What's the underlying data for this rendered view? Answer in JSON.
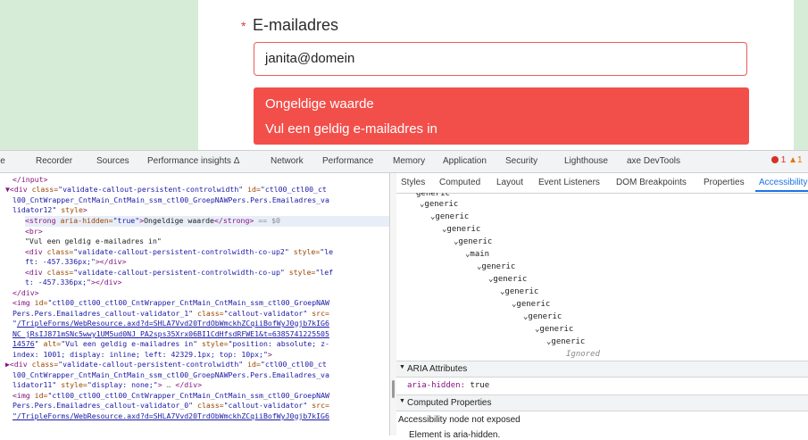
{
  "page": {
    "required_marker": "*",
    "email_label": "E-mailadres",
    "email_value": "janita@domein",
    "error_title": "Ongeldige waarde",
    "error_message": "Vul een geldig e-mailadres in"
  },
  "devtools": {
    "tabs": [
      "le",
      "Recorder",
      "Sources",
      "Performance insights Δ",
      "Network",
      "Performance",
      "Memory",
      "Application",
      "Security",
      "Lighthouse",
      "axe DevTools"
    ],
    "error_count": "1",
    "warning_count": "1",
    "side_tabs": [
      "Styles",
      "Computed",
      "Layout",
      "Event Listeners",
      "DOM Breakpoints",
      "Properties",
      "Accessibility"
    ],
    "active_side_tab": "Accessibility",
    "tree_nodes": [
      "generic",
      "generic",
      "generic",
      "generic",
      "generic",
      "main",
      "generic",
      "generic",
      "generic",
      "generic",
      "generic",
      "generic",
      "generic"
    ],
    "tree_ignored": "Ignored",
    "aria_header": "ARIA Attributes",
    "aria_attr_key": "aria-hidden:",
    "aria_attr_val": "true",
    "computed_header": "Computed Properties",
    "computed_line1": "Accessibility node not exposed",
    "computed_line2": "Element is aria-hidden."
  },
  "elements": {
    "l01": "</input>",
    "l02_tag": "▼<div ",
    "l02_a1": "class=",
    "l02_v1": "\"validate-callout-persistent-controlwidth\"",
    "l02_a2": " id=",
    "l02_v2": "\"ctl00_ctl00_ct",
    "l03": "l00_CntWrapper_CntMain_CntMain_ssm_ctl00_GroepNAWPers.Pers.Emailadres_va",
    "l04_v": "lidator12\"",
    "l04_a": " style",
    "l04_t": ">",
    "l05_t1": "<strong ",
    "l05_a": "aria-hidden=",
    "l05_v": "\"true\"",
    "l05_t2": ">",
    "l05_x": "Ongeldige waarde",
    "l05_t3": "</strong>",
    "l05_c": " == $0",
    "l06": "<br>",
    "l07": "\"Vul een geldig e-mailadres in\"",
    "l08_t": "<div ",
    "l08_a": "class=",
    "l08_v": "\"validate-callout-persistent-controlwidth-co-up2\"",
    "l08_a2": " style=",
    "l08_v2": "\"le",
    "l09_v": "ft: -457.336px;\"",
    "l09_t": "></div>",
    "l10_t": "<div ",
    "l10_a": "class=",
    "l10_v": "\"validate-callout-persistent-controlwidth-co-up\"",
    "l10_a2": " style=",
    "l10_v2": "\"lef",
    "l11_v": "t: -457.336px;\"",
    "l11_t": "></div>",
    "l12": "</div>",
    "l13_t": "<img ",
    "l13_a": "id=",
    "l13_v": "\"ctl00_ctl00_ctl00_CntWrapper_CntMain_CntMain_ssm_ctl00_GroepNAW",
    "l14_v": "Pers.Pers.Emailadres_callout-validator_1\"",
    "l14_a": " class=",
    "l14_v2": "\"callout-validator\"",
    "l14_a2": " src=",
    "l15_q": "\"",
    "l15_lk": "/TripleForms/WebResource.axd?d=SHLA7Vvd20TrdObWmckhZCqiiBofWyJ0gjb7kIG6",
    "l16_lk": "NC_jRsIJ871mSNc5wwy1UM5ud0NJ_PA2sps35Xrx06BI1CdHfsdRFWE1&t=6385741225505",
    "l17_lk": "14576",
    "l17_q": "\"",
    "l17_a": " alt=",
    "l17_v": "\"Vul een geldig e-mailadres in\"",
    "l17_a2": " style=",
    "l17_v2": "\"position: absolute; z-",
    "l18_v": "index: 1001; display: inline; left: 42329.1px; top: 10px;\"",
    "l18_t": ">",
    "l19_t": "▶<div ",
    "l19_a": "class=",
    "l19_v": "\"validate-callout-persistent-controlwidth\"",
    "l19_a2": " id=",
    "l19_v2": "\"ctl00_ctl00_ct",
    "l20": "l00_CntWrapper_CntMain_CntMain_ssm_ctl00_GroepNAWPers.Pers.Emailadres_va",
    "l21_v": "lidator11\"",
    "l21_a": " style=",
    "l21_v2": "\"display: none;\"",
    "l21_t": ">",
    "l21_c": " … ",
    "l21_t2": "</div>",
    "l22_t": "<img ",
    "l22_a": "id=",
    "l22_v": "\"ctl00_ctl00_ctl00_CntWrapper_CntMain_CntMain_ssm_ctl00_GroepNAW",
    "l23_v": "Pers.Pers.Emailadres_callout-validator_0\"",
    "l23_a": " class=",
    "l23_v2": "\"callout-validator\"",
    "l23_a2": " src=",
    "l24_lk": "\"/TripleForms/WebResource.axd?d=SHLA7Vvd20TrdObWmckhZCqiiBofWyJ0gjb7kIG6"
  }
}
